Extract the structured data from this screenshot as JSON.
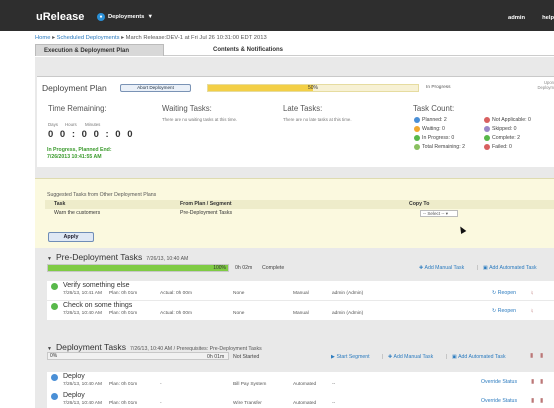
{
  "app": {
    "brand": "uRelease",
    "menu": "Deployments",
    "user": "admin",
    "help": "help"
  },
  "breadcrumb": {
    "home": "Home",
    "sep": "▸",
    "scheduled": "Scheduled Deployments",
    "current": "March Release:DEV-1 at Fri Jul 26 10:31:00 EDT 2013"
  },
  "tabs": [
    "Execution & Deployment Plan",
    "Contents & Notifications"
  ],
  "plan": {
    "title": "Deployment Plan",
    "abort_label": "Abort Deployment",
    "progress": 0.5,
    "progress_text": "50%",
    "status_text": "In Progress",
    "right_hint_1": "Upon",
    "right_hint_2": "Deploym",
    "time_remaining_title": "Time Remaining:",
    "time_labels": [
      "Days",
      "Hours",
      "Minutes"
    ],
    "time_value": "0 0 : 0 0 : 0 0",
    "time_status_1": "In Progress, Planned End:",
    "time_status_2": "7/26/2013 10:41:55 AM",
    "waiting_title": "Waiting Tasks:",
    "waiting_note": "There are no waiting tasks at this time.",
    "late_title": "Late Tasks:",
    "late_note": "There are no late tasks at this time.",
    "task_count_title": "Task Count:",
    "counts": {
      "planned": "Planned: 2",
      "waiting": "Waiting: 0",
      "in_progress": "In Progress: 0",
      "total_remaining": "Total Remaining: 2",
      "not_applicable": "Not Applicable: 0",
      "skipped": "Skipped: 0",
      "complete": "Complete: 2",
      "failed": "Failed: 0"
    },
    "colors": {
      "planned": "#4a8fd6",
      "waiting": "#f0a830",
      "in_progress": "#58b84a",
      "total": "#8ac060",
      "not_applicable": "#d86060",
      "skipped": "#9a88c8",
      "complete": "#58b84a",
      "failed": "#d86060"
    }
  },
  "suggested": {
    "heading": "Suggested Tasks from Other Deployment Plans",
    "columns": [
      "Task",
      "From Plan / Segment",
      "Copy To"
    ],
    "rows": [
      {
        "task": "Warn the customers",
        "from": "Pre-Deployment Tasks",
        "copy_to": "-- Select -- ▾"
      }
    ],
    "apply_label": "Apply"
  },
  "pre_deployment": {
    "title": "Pre-Deployment Tasks",
    "subtitle": "7/26/13, 10:40 AM",
    "progress": 1.0,
    "progress_text": "100%",
    "duration": "0h 02m",
    "status": "Complete",
    "add_manual": "Add Manual Task",
    "sep": "|",
    "add_automated": "Add Automated Task",
    "tasks": [
      {
        "name": "Verify something else",
        "date": "7/26/13, 10:41 AM",
        "plan": "Plan: 0h 01m",
        "actual": "Actual: 0h 00m",
        "who": "None",
        "type": "Manual",
        "owner": "admin (Admin)",
        "action": "Reopen"
      },
      {
        "name": "Check on some things",
        "date": "7/26/13, 10:40 AM",
        "plan": "Plan: 0h 01m",
        "actual": "Actual: 0h 00m",
        "who": "None",
        "type": "Manual",
        "owner": "admin (Admin)",
        "action": "Reopen"
      }
    ]
  },
  "deployment": {
    "title": "Deployment Tasks",
    "subtitle": "7/26/13, 10:40 AM / Prerequisites: Pre-Deployment Tasks",
    "progress": 0,
    "progress_text": "0%",
    "duration": "0h 01m",
    "status": "Not Started",
    "start_segment": "Start Segment",
    "sep": "|",
    "add_manual": "Add Manual Task",
    "add_automated": "Add Automated Task",
    "tasks": [
      {
        "name": "Deploy",
        "date": "7/26/13, 10:40 AM",
        "plan": "Plan: 0h 01m",
        "actual": "-",
        "who": "Bill Pay System",
        "type": "Automated",
        "owner": "--",
        "action": "Override Status"
      },
      {
        "name": "Deploy",
        "date": "7/26/13, 10:40 AM",
        "plan": "Plan: 0h 01m",
        "actual": "-",
        "who": "Wire Transfer",
        "type": "Automated",
        "owner": "--",
        "action": "Override Status"
      }
    ]
  }
}
